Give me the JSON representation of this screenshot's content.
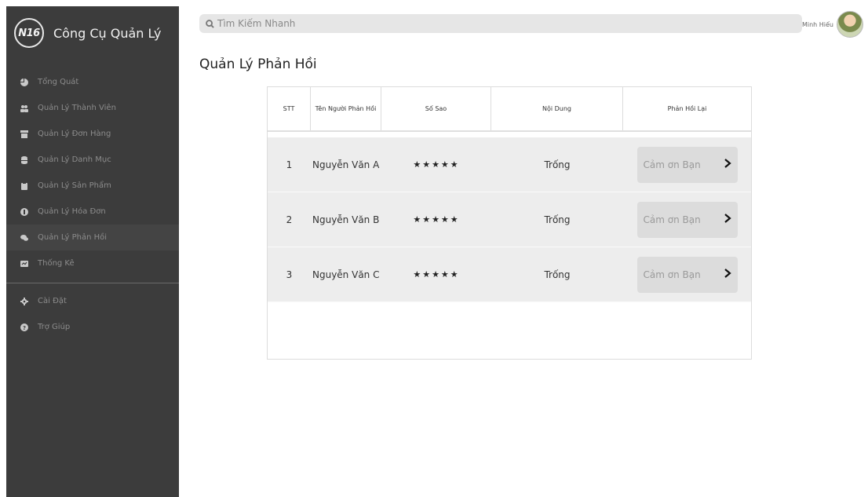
{
  "brand": {
    "logo": "N16",
    "title": "Công Cụ Quản Lý"
  },
  "nav": {
    "items": [
      {
        "label": "Tổng Quát",
        "icon": "pie-chart-icon",
        "active": false
      },
      {
        "label": "Quản Lý Thành Viên",
        "icon": "users-icon",
        "active": false
      },
      {
        "label": "Quản Lý Đơn Hàng",
        "icon": "archive-icon",
        "active": false
      },
      {
        "label": "Quản Lý Danh Mục",
        "icon": "database-icon",
        "active": false
      },
      {
        "label": "Quản Lý Sản Phẩm",
        "icon": "clipboard-icon",
        "active": false
      },
      {
        "label": "Quản Lý Hóa Đơn",
        "icon": "currency-icon",
        "active": false
      },
      {
        "label": "Quản Lý Phản Hồi",
        "icon": "comments-icon",
        "active": true
      },
      {
        "label": "Thống Kê",
        "icon": "chart-box-icon",
        "active": false
      }
    ],
    "bottom_items": [
      {
        "label": "Cài Đặt",
        "icon": "gear-icon"
      },
      {
        "label": "Trợ Giúp",
        "icon": "help-icon"
      }
    ]
  },
  "search": {
    "placeholder": "Tìm Kiếm Nhanh"
  },
  "user": {
    "name": "Minh Hiếu"
  },
  "page": {
    "title": "Quản Lý Phản Hồi"
  },
  "table": {
    "headers": {
      "stt": "STT",
      "name": "Tên Người Phản Hồi",
      "stars": "Số Sao",
      "content": "Nội Dung",
      "reply": "Phản Hồi Lại"
    },
    "rows": [
      {
        "stt": "1",
        "name": "Nguyễn Văn A",
        "stars": "★★★★★",
        "content": "Trống",
        "reply": "Cảm ơn Bạn"
      },
      {
        "stt": "2",
        "name": "Nguyễn Văn B",
        "stars": "★★★★★",
        "content": "Trống",
        "reply": "Cảm ơn Bạn"
      },
      {
        "stt": "3",
        "name": "Nguyễn Văn C",
        "stars": "★★★★★",
        "content": "Trống",
        "reply": "Cảm ơn Bạn"
      }
    ]
  },
  "colors": {
    "sidebar": "#3c3c3c",
    "row": "#ededed",
    "reply_box": "#dcdcdc"
  }
}
